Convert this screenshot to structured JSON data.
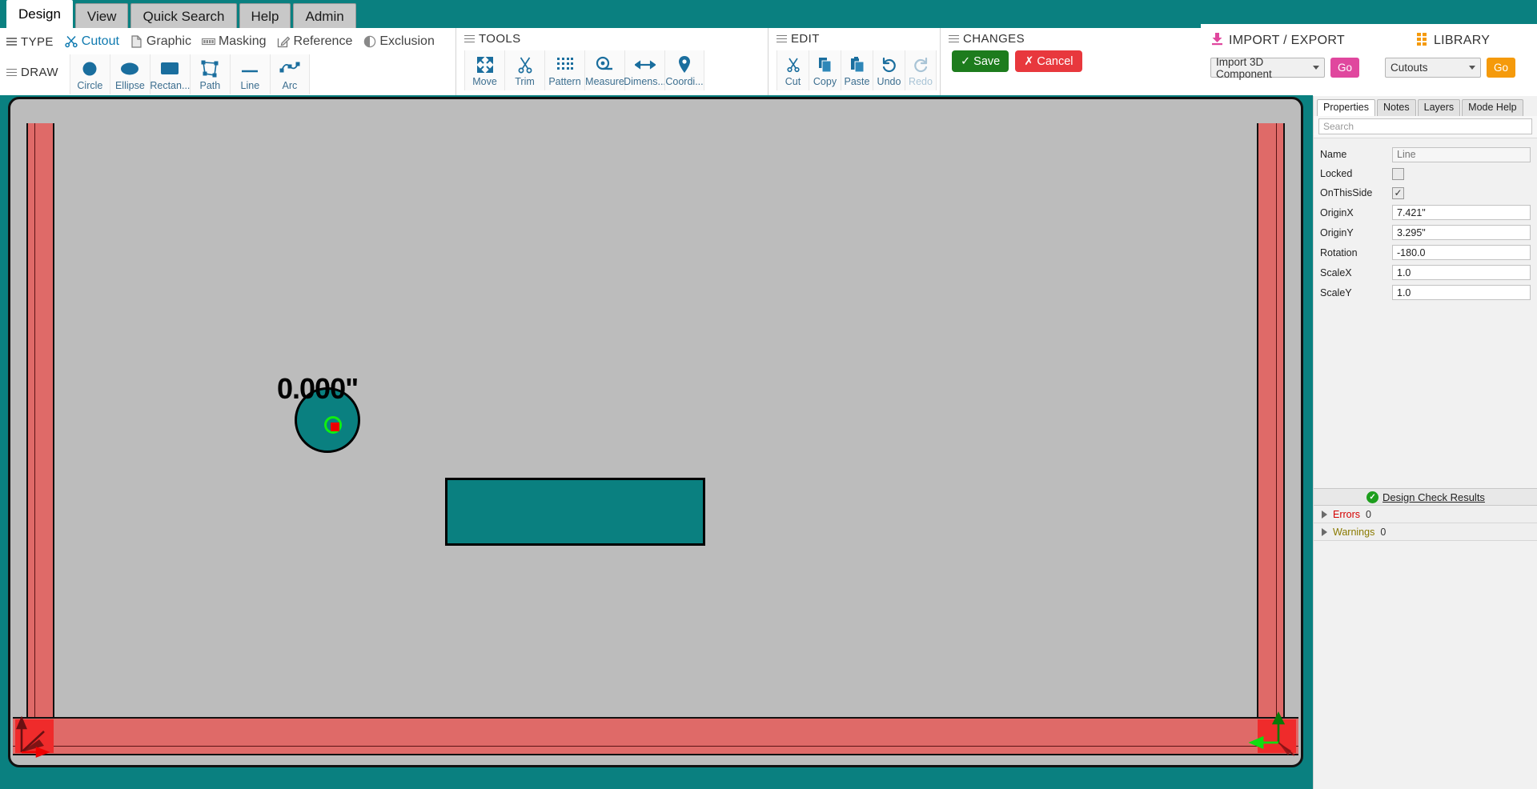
{
  "tabs": [
    {
      "label": "Design",
      "active": true
    },
    {
      "label": "View",
      "active": false
    },
    {
      "label": "Quick Search",
      "active": false
    },
    {
      "label": "Help",
      "active": false
    },
    {
      "label": "Admin",
      "active": false
    }
  ],
  "ribbon": {
    "type_group_label": "TYPE",
    "type_items": [
      {
        "label": "Cutout",
        "icon": "scissors-icon",
        "selected": true
      },
      {
        "label": "Graphic",
        "icon": "document-icon",
        "selected": false
      },
      {
        "label": "Masking",
        "icon": "masking-icon",
        "selected": false
      },
      {
        "label": "Reference",
        "icon": "edit-square-icon",
        "selected": false
      },
      {
        "label": "Exclusion",
        "icon": "half-circle-icon",
        "selected": false
      }
    ],
    "draw_group_label": "DRAW",
    "draw_items": [
      {
        "label": "Circle",
        "icon": "circle-icon"
      },
      {
        "label": "Ellipse",
        "icon": "ellipse-icon"
      },
      {
        "label": "Rectan...",
        "icon": "rectangle-icon"
      },
      {
        "label": "Path",
        "icon": "path-icon"
      },
      {
        "label": "Line",
        "icon": "line-icon"
      },
      {
        "label": "Arc",
        "icon": "arc-icon"
      }
    ],
    "tools_group_label": "TOOLS",
    "tools_items": [
      {
        "label": "Move",
        "icon": "move-icon"
      },
      {
        "label": "Trim",
        "icon": "trim-scissors-icon"
      },
      {
        "label": "Pattern",
        "icon": "pattern-dots-icon"
      },
      {
        "label": "Measure",
        "icon": "measure-tape-icon"
      },
      {
        "label": "Dimens...",
        "icon": "dimension-arrow-icon"
      },
      {
        "label": "Coordi...",
        "icon": "map-pin-icon"
      }
    ],
    "edit_group_label": "EDIT",
    "edit_items": [
      {
        "label": "Cut",
        "icon": "cut-scissors-icon",
        "disabled": false
      },
      {
        "label": "Copy",
        "icon": "copy-icon",
        "disabled": false
      },
      {
        "label": "Paste",
        "icon": "paste-icon",
        "disabled": false
      },
      {
        "label": "Undo",
        "icon": "undo-icon",
        "disabled": false
      },
      {
        "label": "Redo",
        "icon": "redo-icon",
        "disabled": true
      }
    ],
    "changes_group_label": "CHANGES",
    "save_label": "Save",
    "cancel_label": "Cancel"
  },
  "right_ribbon": {
    "import_export_title": "IMPORT / EXPORT",
    "import_export_icon": "download-icon",
    "import_select_value": "Import 3D Component",
    "import_go_label": "Go",
    "library_title": "LIBRARY",
    "library_icon": "grid-dots-icon",
    "library_select_value": "Cutouts",
    "library_go_label": "Go"
  },
  "properties_panel": {
    "tabs": [
      {
        "label": "Properties",
        "active": true
      },
      {
        "label": "Notes",
        "active": false
      },
      {
        "label": "Layers",
        "active": false
      },
      {
        "label": "Mode Help",
        "active": false
      }
    ],
    "search_placeholder": "Search",
    "search_value": "",
    "rows": [
      {
        "label": "Name",
        "type": "text",
        "value": "",
        "placeholder": "Line",
        "readonly": true
      },
      {
        "label": "Locked",
        "type": "checkbox",
        "checked": false
      },
      {
        "label": "OnThisSide",
        "type": "checkbox",
        "checked": true
      },
      {
        "label": "OriginX",
        "type": "text",
        "value": "7.421\"",
        "readonly": false
      },
      {
        "label": "OriginY",
        "type": "text",
        "value": "3.295\"",
        "readonly": false
      },
      {
        "label": "Rotation",
        "type": "text",
        "value": "-180.0",
        "readonly": false
      },
      {
        "label": "ScaleX",
        "type": "text",
        "value": "1.0",
        "readonly": false
      },
      {
        "label": "ScaleY",
        "type": "text",
        "value": "1.0",
        "readonly": false
      }
    ],
    "design_check": {
      "title": "Design Check Results",
      "status_icon": "green-check-icon",
      "errors_label": "Errors",
      "errors_count": "0",
      "warnings_label": "Warnings",
      "warnings_count": "0"
    }
  },
  "canvas": {
    "dimension_label": "0.000\"",
    "sheet_color": "#bcbcbc",
    "shape_fill": "#0a8080",
    "band_color": "#df6a68",
    "hot_corner_color": "#ef2b2b",
    "origin_marker_color": "#ee0000",
    "snap_marker_color": "#11ee11",
    "background_color": "#0a8080"
  }
}
